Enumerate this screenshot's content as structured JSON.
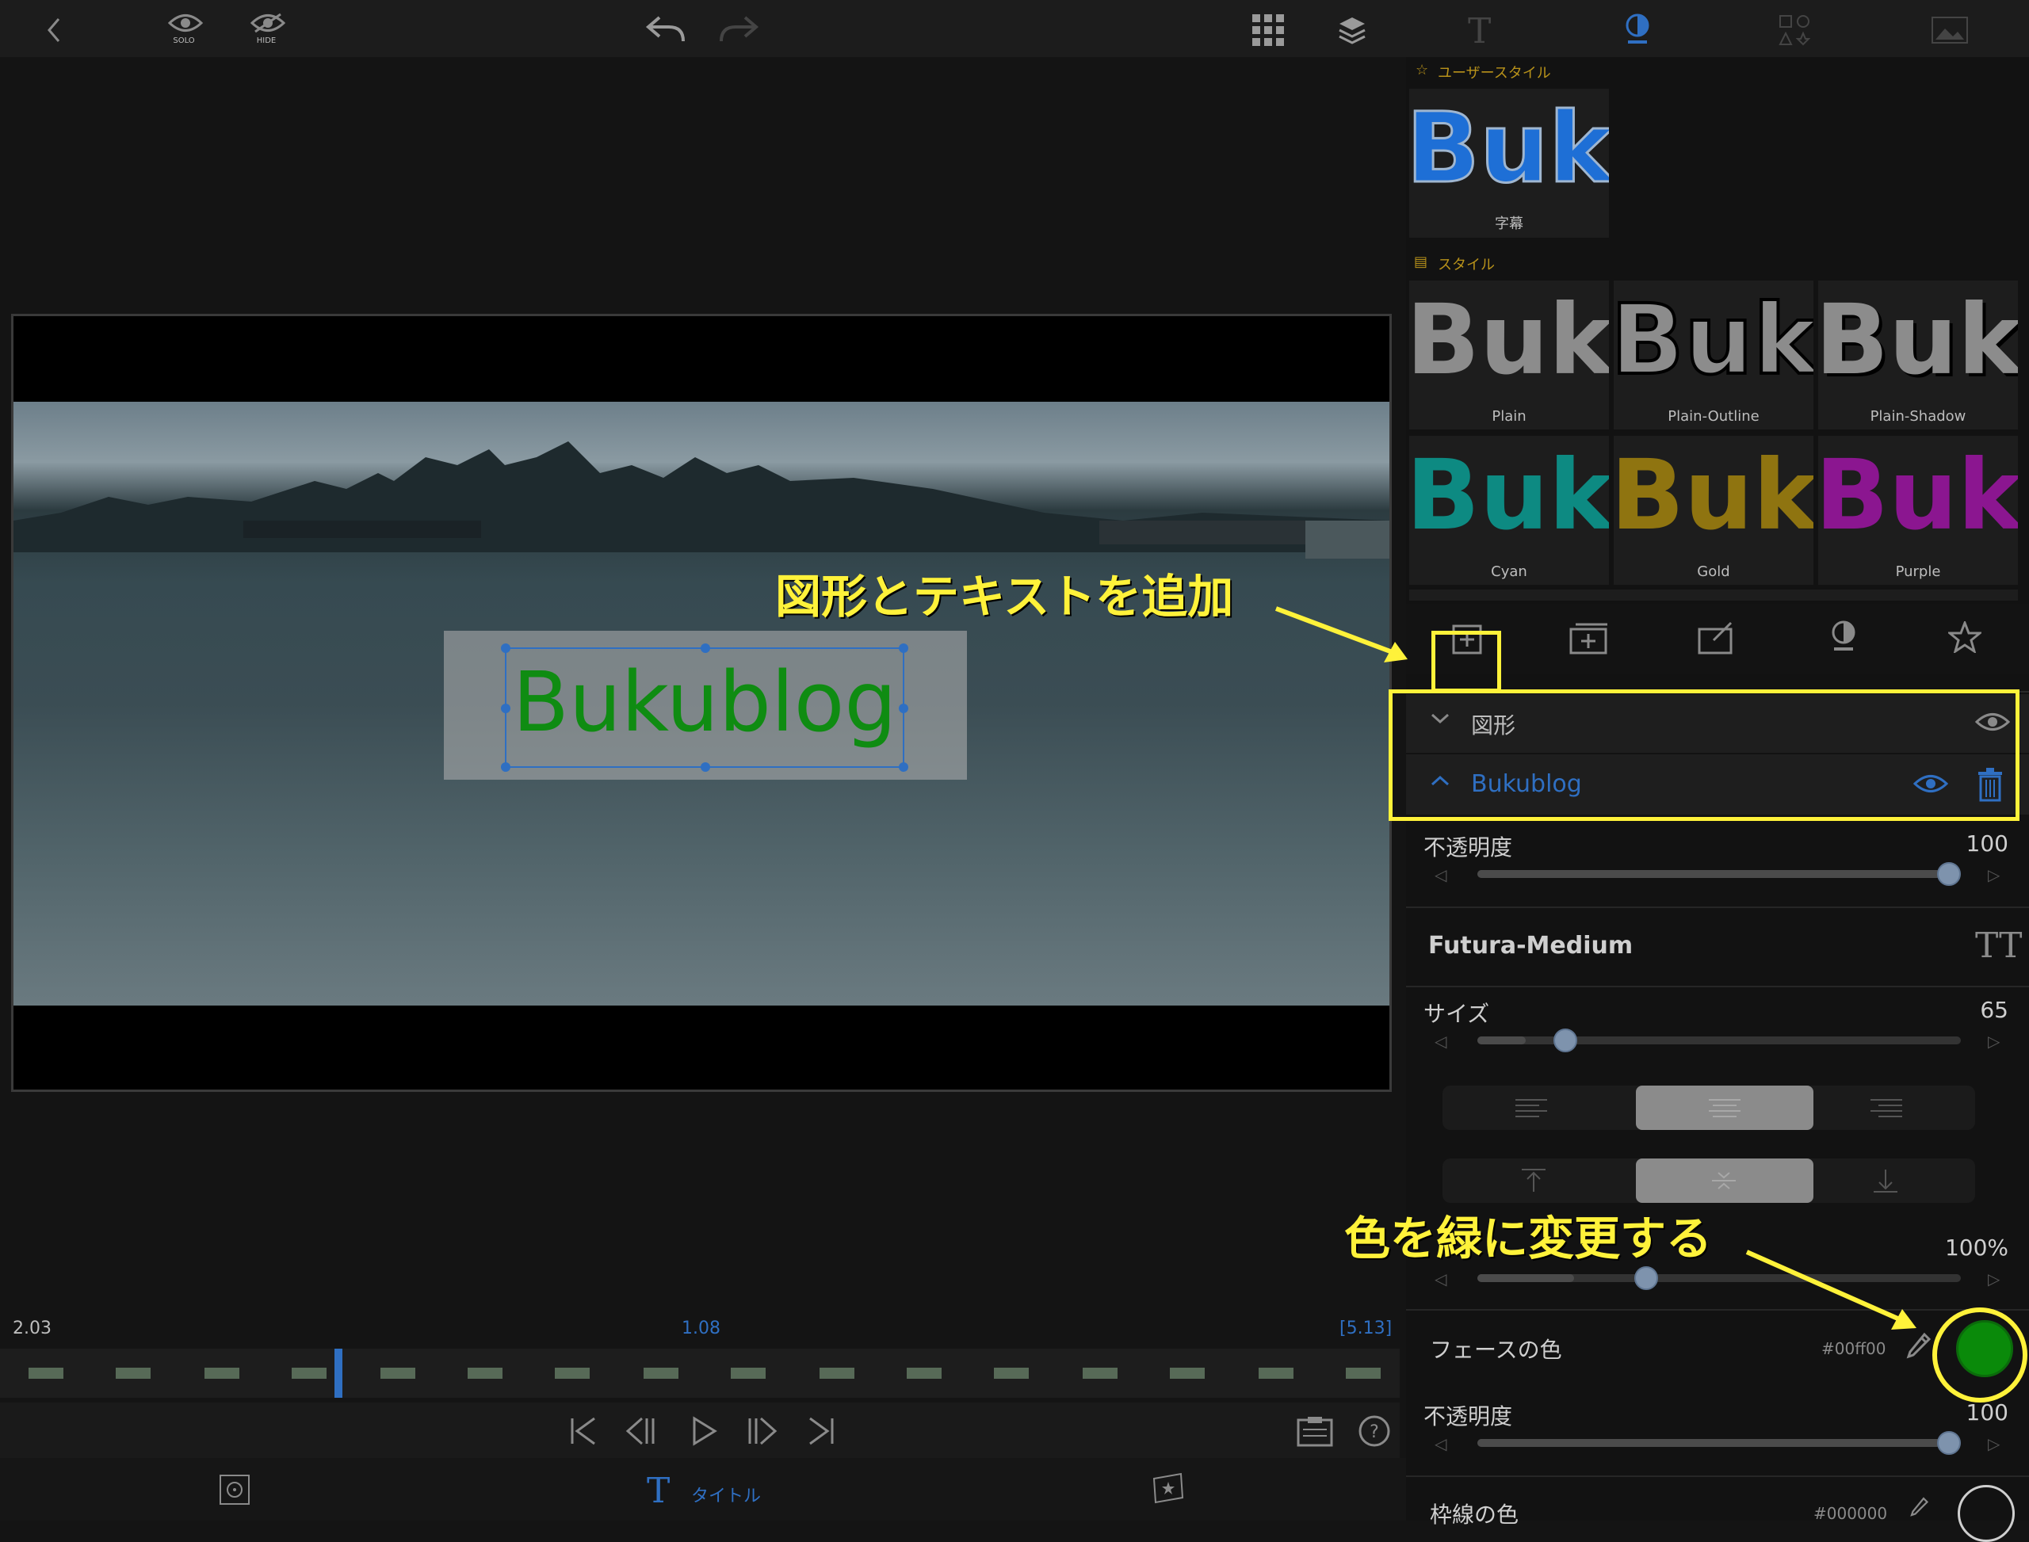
{
  "toolbar": {
    "solo_label": "SOLO",
    "hide_label": "HIDE"
  },
  "panel": {
    "user_style_header": "ユーザースタイル",
    "style_header": "スタイル",
    "user_styles": [
      {
        "label": "字幕",
        "sample": "Buku",
        "color": "#1e6fd6"
      }
    ],
    "styles": [
      {
        "label": "Plain",
        "sample": "Buku",
        "color": "#8c8c8c"
      },
      {
        "label": "Plain-Outline",
        "sample": "Buku",
        "color": "#8c8c8c"
      },
      {
        "label": "Plain-Shadow",
        "sample": "Buku",
        "color": "#8c8c8c"
      },
      {
        "label": "Cyan",
        "sample": "Buku",
        "color": "#0d8a82"
      },
      {
        "label": "Gold",
        "sample": "Buku",
        "color": "#8f7410"
      },
      {
        "label": "Purple",
        "sample": "Buku",
        "color": "#8b1690"
      }
    ],
    "layers": {
      "shape_label": "図形",
      "text_label": "Bukublog"
    },
    "opacity_label": "不透明度",
    "opacity_value": "100",
    "font_name": "Futura-Medium",
    "size_label": "サイズ",
    "size_value": "65",
    "line_spacing_value": "100%",
    "face_color_label": "フェースの色",
    "face_color_hex": "#00ff00",
    "face_color": "#0a8a0a",
    "opacity2_label": "不透明度",
    "opacity2_value": "100",
    "outline_label": "枠線の色",
    "outline_hex": "#000000"
  },
  "preview": {
    "title_text": "Bukublog",
    "title_color": "#0f8c12"
  },
  "timeline": {
    "left_time": "2.03",
    "center_time": "1.08",
    "right_time": "[5.13]"
  },
  "bottom_tabs": {
    "title_label": "タイトル"
  },
  "annotations": {
    "add_shape_text": "図形とテキストを追加",
    "change_color": "色を緑に変更する"
  },
  "colors": {
    "accent_blue": "#2f6fc2",
    "annotation_yellow": "#fff23a",
    "style_header_gold": "#b8921a"
  }
}
